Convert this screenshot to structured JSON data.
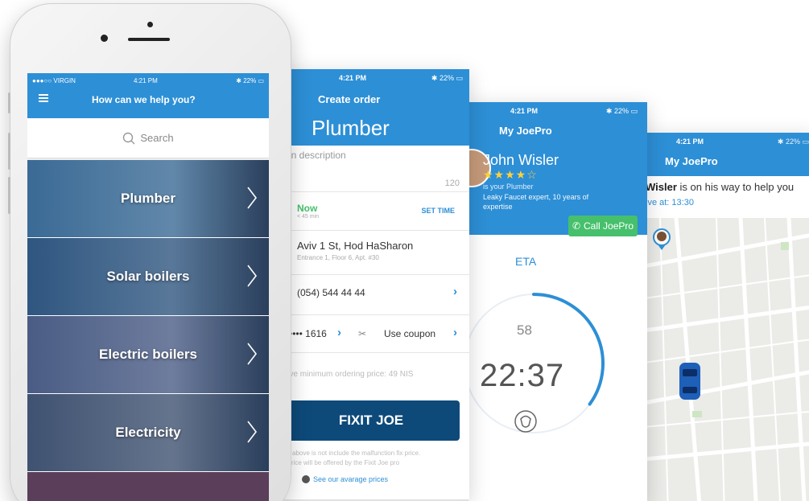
{
  "screen_map": {
    "time": "4:21 PM",
    "battery": "22%",
    "title": "My JoePro",
    "message_name": "Wisler",
    "message_rest": " is on his way to help you",
    "arrive": "ive at: 13:30"
  },
  "screen_eta": {
    "time": "4:21 PM",
    "battery": "22%",
    "title": "My JoePro",
    "pro_name": "John Wisler",
    "rating": 4,
    "stars": "★★★★☆",
    "role": "is your Plumber",
    "bio": "Leaky Faucet expert, 10 years of expertise",
    "call_label": "Call JoePro",
    "eta_label": "ETA",
    "seconds": "58",
    "countdown": "22:37",
    "progress": 0.35
  },
  "screen_order": {
    "time": "4:21 PM",
    "battery": "22%",
    "title": "Create order",
    "service": "Plumber",
    "description_placeholder": "on description",
    "char_count": "120",
    "when": "Now",
    "when_sub": "< 45 min",
    "set_time": "SET TIME",
    "address": "Aviv 1 St, Hod HaSharon",
    "address_detail": "Entrance 1, Floor 6, Apt. #30",
    "phone": "(054) 544 44 44",
    "card": "•••• 1616",
    "coupon": "Use coupon",
    "min_price": "prove minimum ordering price: 49 NIS",
    "fixit": "FIXIT JOE",
    "note1": "above is not include the malfunction fix price.",
    "note2": "al price will be offered by the Fixit Joe pro",
    "avg_prices": "See our avarage prices"
  },
  "screen_home": {
    "carrier": "●●●○○ VIRGIN",
    "time": "4:21 PM",
    "battery": "22%",
    "title": "How can we help you?",
    "search_placeholder": "Search",
    "categories": [
      {
        "label": "Plumber",
        "color": "#3a6a95"
      },
      {
        "label": "Solar boilers",
        "color": "#2f5680"
      },
      {
        "label": "Electric boilers",
        "color": "#4a5c85"
      },
      {
        "label": "Electricity",
        "color": "#3f5271"
      }
    ]
  },
  "colors": {
    "primary": "#2d8fd6",
    "green": "#46c06c",
    "dark_button": "#0d4a7a"
  }
}
